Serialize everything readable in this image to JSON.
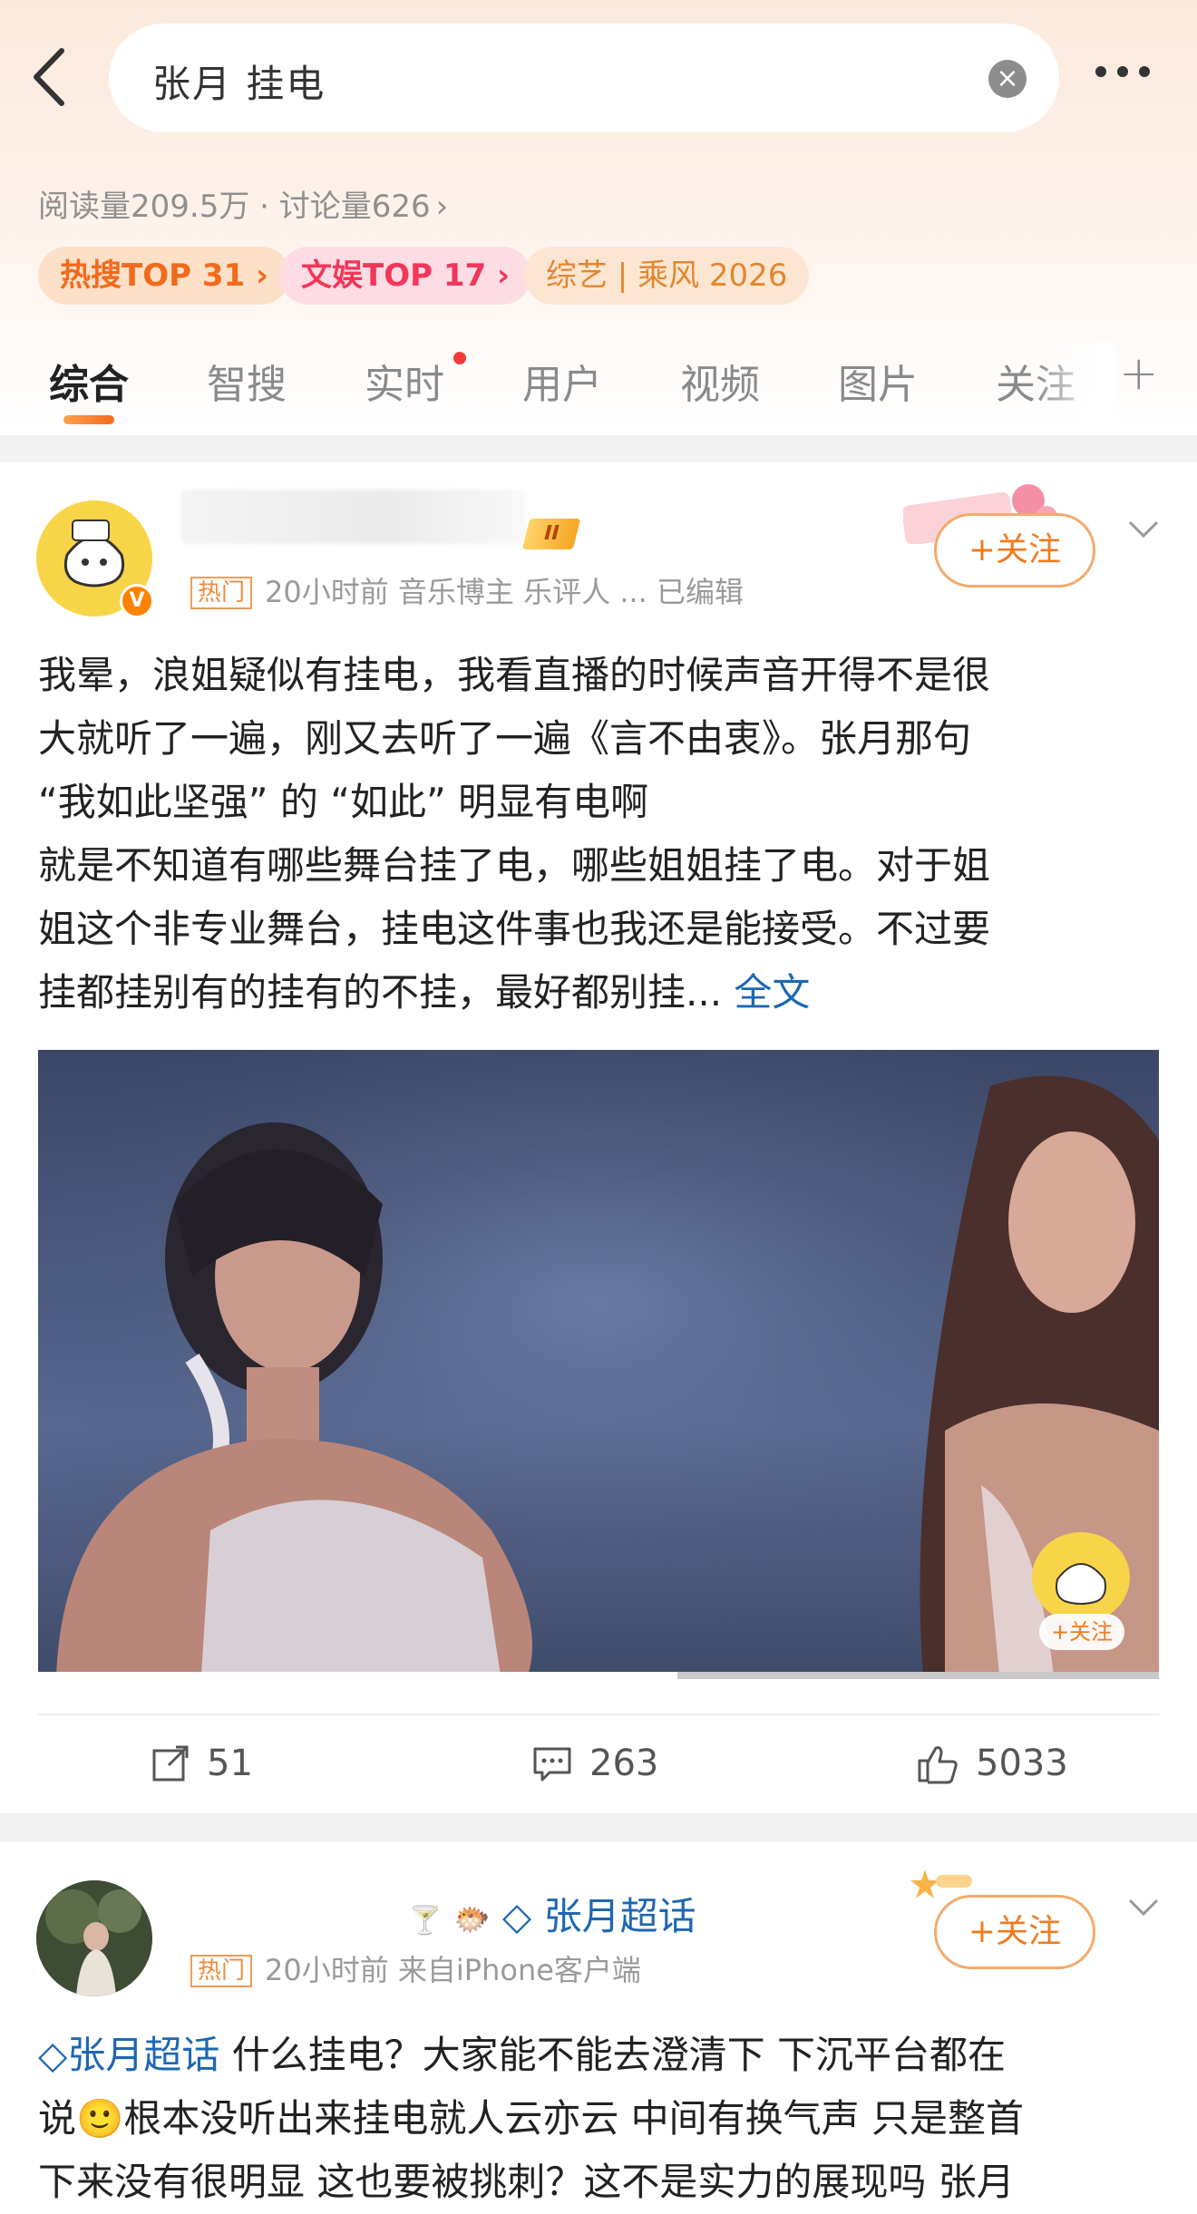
{
  "header": {
    "search_query": "张月 挂电",
    "stats": "阅读量209.5万 · 讨论量626",
    "tags": [
      "热搜TOP 31",
      "文娱TOP 17",
      "综艺 | 乘风 2026"
    ]
  },
  "tabs": [
    "综合",
    "智搜",
    "实时",
    "用户",
    "视频",
    "图片",
    "关注"
  ],
  "post1": {
    "hot_label": "热门",
    "meta": "20小时前  音乐博主 乐评人 ...  已编辑",
    "level": "II",
    "follow_label": "+关注",
    "text_lines": [
      "我晕，浪姐疑似有挂电，我看直播的时候声音开得不是很",
      "大就听了一遍，刚又去听了一遍《言不由衷》。张月那句",
      "“我如此坚强” 的 “如此” 明显有电啊",
      "就是不知道有哪些舞台挂了电，哪些姐姐挂了电。对于姐",
      "姐这个非专业舞台，挂电这件事也我还是能接受。不过要",
      "挂都挂别有的挂有的不挂，最好都别挂..."
    ],
    "more_link": "全文",
    "video_progress": 0.57,
    "watermark_follow": "+关注",
    "reposts": "51",
    "comments": "263",
    "likes": "5033"
  },
  "post2": {
    "name": "张月超话",
    "hot_label": "热门",
    "meta": "20小时前  来自iPhone客户端",
    "follow_label": "+关注",
    "topic": "张月超话",
    "text_line1": " 什么挂电？大家能不能去澄清下 下沉平台都在",
    "text_line2a": "说",
    "text_line2b": "根本没听出来挂电就人云亦云 中间有换气声 只是整首",
    "text_line3": "下来没有很明显 这也要被挑刺？这不是实力的展现吗 张月"
  },
  "colors": {
    "accent_orange": "#f07b1f",
    "link_blue": "#1e67b1",
    "hot_red": "#f1365a"
  }
}
